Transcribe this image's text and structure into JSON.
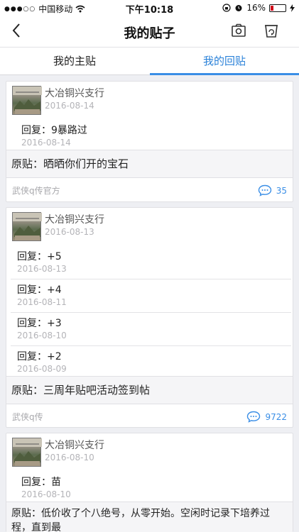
{
  "status": {
    "carrier": "中国移动",
    "time": "下午10:18",
    "battery": "16%"
  },
  "nav": {
    "title": "我的贴子",
    "icons": [
      "back-arrow-icon",
      "camera-icon",
      "recycle-icon"
    ]
  },
  "tabs": [
    {
      "label": "我的主贴"
    },
    {
      "label": "我的回贴",
      "active": true
    }
  ],
  "accent": "#3a8ee6",
  "cards": [
    {
      "user": "大冶铜兴支行",
      "date": "2016-08-14",
      "replies": [
        {
          "text": "回复：9暴路过",
          "date": "2016-08-14"
        }
      ],
      "original": "原贴：晒晒你们开的宝石",
      "forum": "武侠q传官方",
      "count": "35"
    },
    {
      "user": "大冶铜兴支行",
      "date": "2016-08-13",
      "replies": [
        {
          "text": "回复：+5",
          "date": "2016-08-13"
        },
        {
          "text": "回复：+4",
          "date": "2016-08-11"
        },
        {
          "text": "回复：+3",
          "date": "2016-08-10"
        },
        {
          "text": "回复：+2",
          "date": "2016-08-09"
        }
      ],
      "original": "原贴：三周年贴吧活动签到帖",
      "forum": "武侠q传",
      "count": "9722"
    },
    {
      "user": "大冶铜兴支行",
      "date": "2016-08-10",
      "replies": [
        {
          "text": "回复：苗",
          "date": "2016-08-10"
        }
      ],
      "original": "原贴：低价收了个八绝号，从零开始。空闲时记录下培养过程，直到最"
    }
  ]
}
